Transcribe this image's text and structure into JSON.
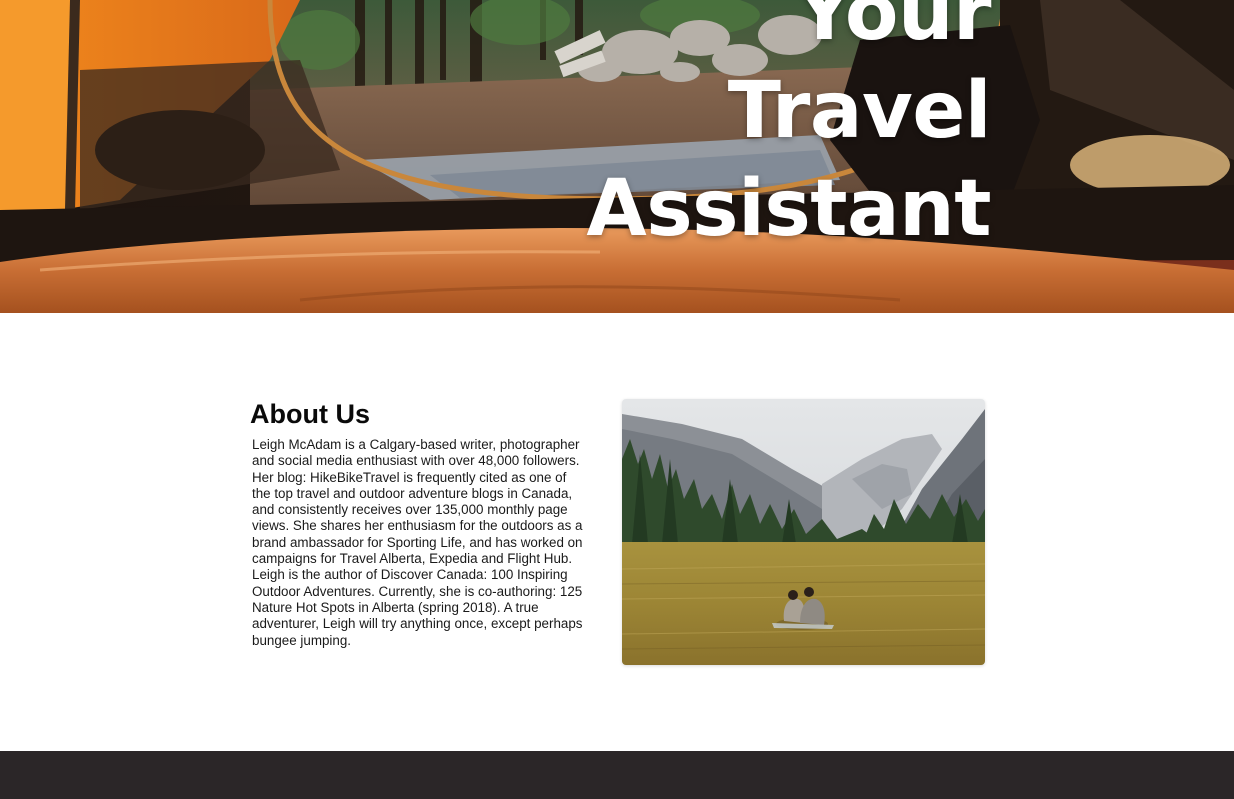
{
  "hero": {
    "title_lines": [
      "Your",
      "Travel",
      "Assistant"
    ],
    "image": "camping-tent-view-photo"
  },
  "about": {
    "heading": "About Us",
    "body": "Leigh McAdam is a Calgary-based writer, photographer and social media enthusiast with over 48,000 followers. Her blog: HikeBikeTravel is frequently cited as one of the top travel and outdoor adventure blogs in Canada, and consistently receives over 135,000 monthly page views. She shares her enthusiasm for the outdoors as a brand ambassador for Sporting Life, and has worked on campaigns for Travel Alberta, Expedia and Flight Hub. Leigh is the author of Discover Canada: 100 Inspiring Outdoor Adventures. Currently, she is co-authoring: 125 Nature Hot Spots in Alberta (spring 2018). A true adventurer, Leigh will try anything once, except perhaps bungee jumping.",
    "image": "yosemite-meadow-photo"
  },
  "colors": {
    "footer_bg": "#2b2628",
    "tent_orange": "#e37a1a"
  }
}
